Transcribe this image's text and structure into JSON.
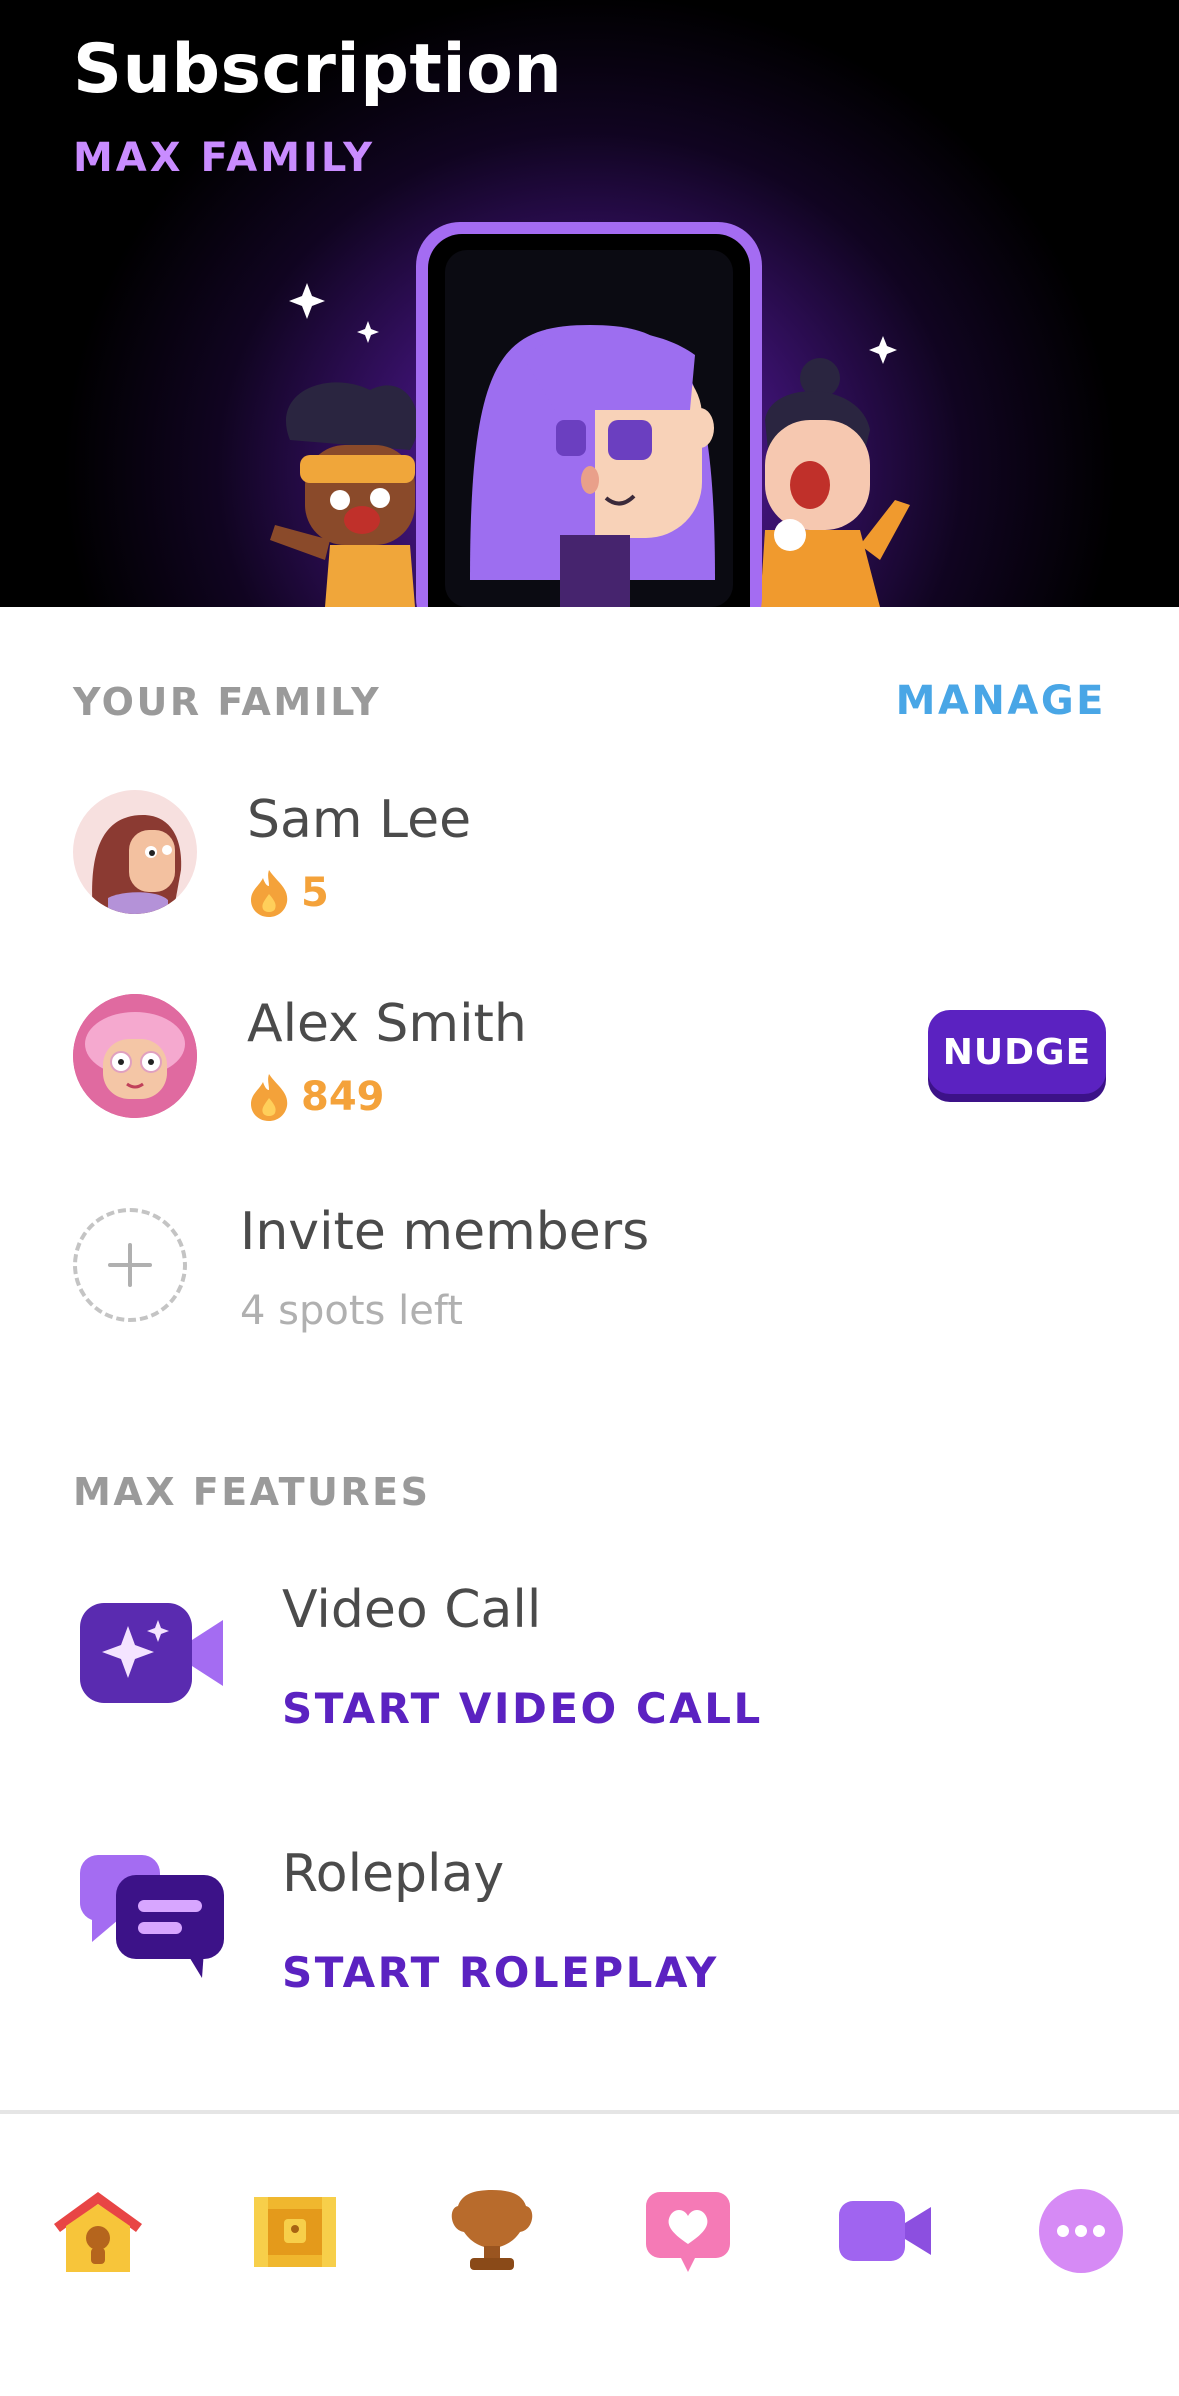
{
  "header": {
    "title": "Subscription",
    "plan": "MAX FAMILY"
  },
  "family": {
    "section_label": "YOUR FAMILY",
    "manage_label": "MANAGE",
    "members": [
      {
        "name": "Sam Lee",
        "streak": "5"
      },
      {
        "name": "Alex Smith",
        "streak": "849",
        "action": "NUDGE"
      }
    ],
    "invite": {
      "label": "Invite members",
      "sublabel": "4 spots left"
    }
  },
  "features": {
    "section_label": "MAX FEATURES",
    "items": [
      {
        "title": "Video Call",
        "action": "START VIDEO CALL",
        "icon": "video-sparkle-icon"
      },
      {
        "title": "Roleplay",
        "action": "START ROLEPLAY",
        "icon": "chat-bubbles-icon"
      }
    ]
  },
  "tabbar": {
    "tabs": [
      {
        "icon": "home-icon",
        "active": true
      },
      {
        "icon": "treasure-chest-icon"
      },
      {
        "icon": "trophy-icon"
      },
      {
        "icon": "heart-chat-icon"
      },
      {
        "icon": "video-camera-icon"
      },
      {
        "icon": "more-icon"
      }
    ]
  },
  "colors": {
    "accent_purple": "#5b22c1",
    "link_blue": "#49a6e6",
    "streak_orange": "#f4a23a",
    "plan_lilac": "#c98cff"
  }
}
